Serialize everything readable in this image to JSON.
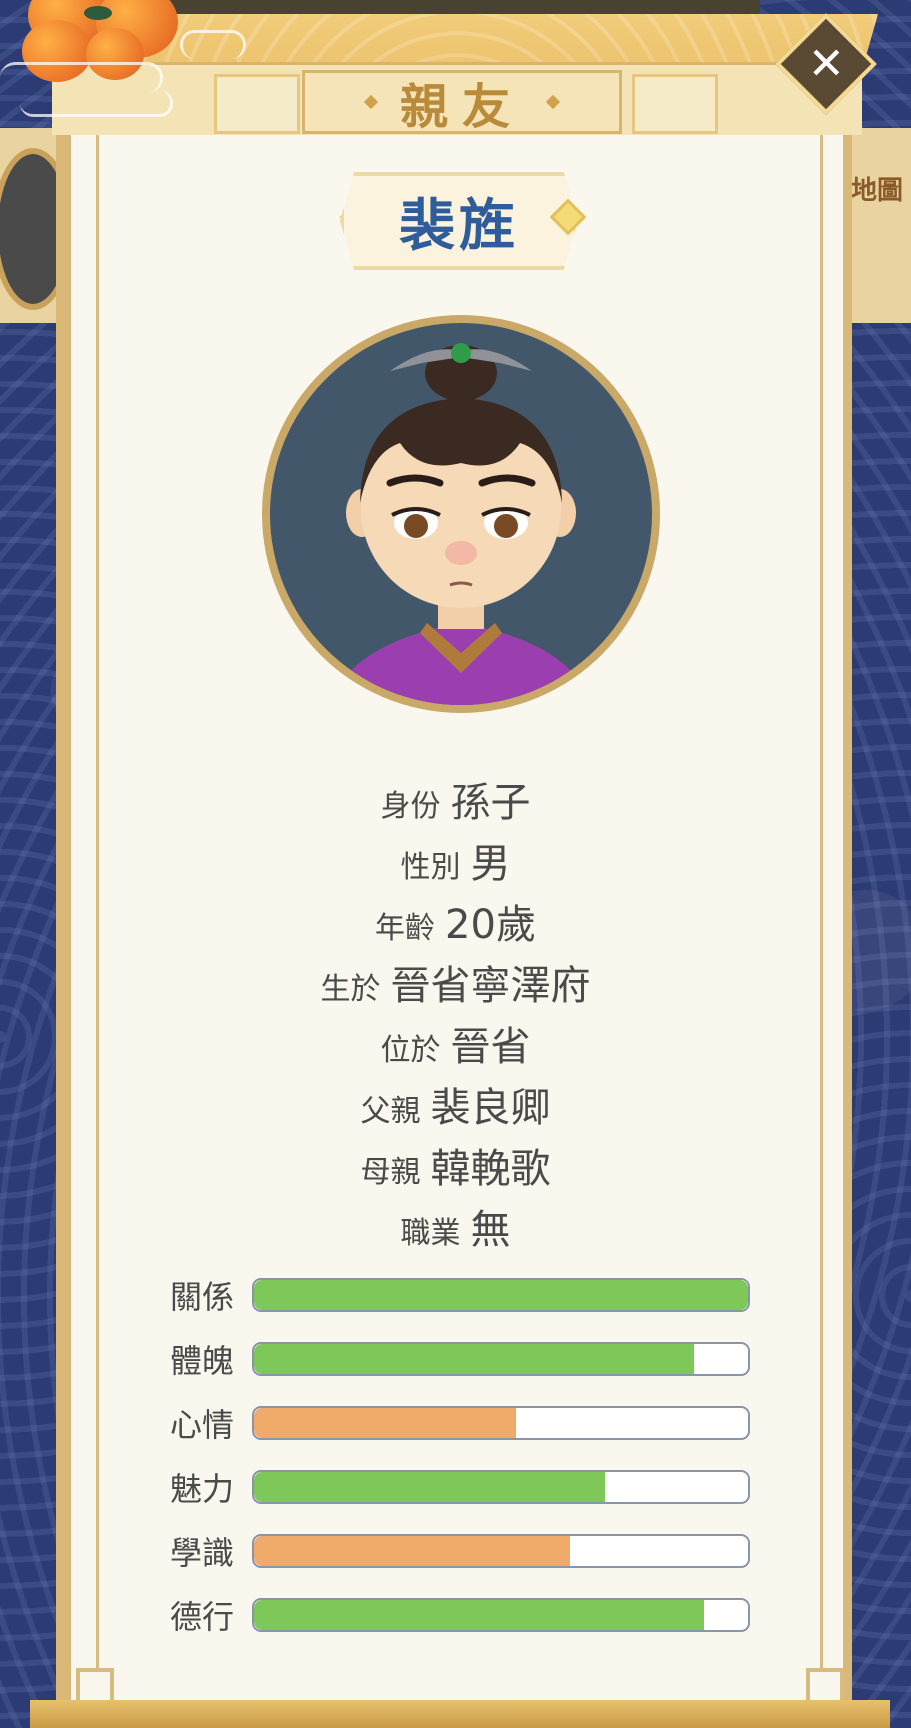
{
  "dialog": {
    "title": "親友",
    "close_label": "✕"
  },
  "background": {
    "map_label": "地圖"
  },
  "character": {
    "name": "裴旌"
  },
  "info": [
    {
      "label": "身份",
      "value": "孫子"
    },
    {
      "label": "性別",
      "value": "男"
    },
    {
      "label": "年齡",
      "value": "20歲"
    },
    {
      "label": "生於",
      "value": "晉省寧澤府"
    },
    {
      "label": "位於",
      "value": "晉省"
    },
    {
      "label": "父親",
      "value": "裴良卿"
    },
    {
      "label": "母親",
      "value": "韓輓歌"
    },
    {
      "label": "職業",
      "value": "無"
    }
  ],
  "stats": [
    {
      "label": "關係",
      "fill": 1.0,
      "color": "#7ec85a"
    },
    {
      "label": "體魄",
      "fill": 0.89,
      "color": "#7ec85a"
    },
    {
      "label": "心情",
      "fill": 0.53,
      "color": "#f0aa6a"
    },
    {
      "label": "魅力",
      "fill": 0.71,
      "color": "#7ec85a"
    },
    {
      "label": "學識",
      "fill": 0.64,
      "color": "#f0aa6a"
    },
    {
      "label": "德行",
      "fill": 0.91,
      "color": "#7ec85a"
    }
  ]
}
